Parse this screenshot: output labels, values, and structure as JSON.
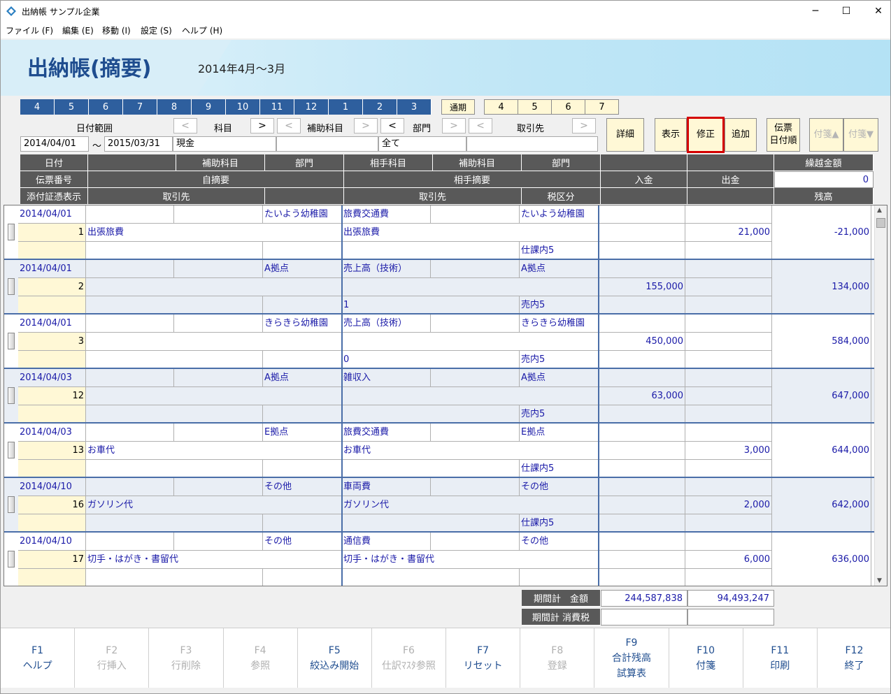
{
  "window": {
    "title": "出納帳 サンプル企業"
  },
  "menu": [
    "ファイル (F)",
    "編集 (E)",
    "移動 (I)",
    "設定 (S)",
    "ヘルプ (H)"
  ],
  "banner": {
    "title": "出納帳(摘要)",
    "period": "2014年4月～3月"
  },
  "months": [
    "4",
    "5",
    "6",
    "7",
    "8",
    "9",
    "10",
    "11",
    "12",
    "1",
    "2",
    "3"
  ],
  "months_extra": [
    "4",
    "5",
    "6",
    "7"
  ],
  "full_period": "通期",
  "filter": {
    "date_range_label": "日付範囲",
    "subject_label": "科目",
    "sub_subject_label": "補助科目",
    "dept_label": "部門",
    "partner_label": "取引先",
    "date_from": "2014/04/01",
    "tilde": "～",
    "date_to": "2015/03/31",
    "subject_value": "現金",
    "dept_value": "全て",
    "prev": "<",
    "next": ">"
  },
  "buttons": {
    "detail": "詳細",
    "show": "表示",
    "edit": "修正",
    "add": "追加",
    "slip_line1": "伝票",
    "slip_line2": "日付順",
    "fusen_up": "付箋▲",
    "fusen_down": "付箋▼"
  },
  "headers": {
    "date": "日付",
    "sub": "補助科目",
    "dept": "部門",
    "partner_subject": "相手科目",
    "partner_sub": "補助科目",
    "partner_dept": "部門",
    "carry": "繰越金額",
    "carry_value": "0",
    "slip_no": "伝票番号",
    "own_desc": "自摘要",
    "partner_desc": "相手摘要",
    "deposit": "入金",
    "withdraw": "出金",
    "attach": "添付証憑表示",
    "client": "取引先",
    "client2": "取引先",
    "tax": "税区分",
    "balance": "残高"
  },
  "entries": [
    {
      "date": "2014/04/01",
      "dept": "たいよう幼稚園",
      "psubj": "旅費交通費",
      "pdept": "たいよう幼稚園",
      "no": "1",
      "desc": "出張旅費",
      "pdesc": "出張旅費",
      "client": "",
      "tax": "仕課内5",
      "in": "",
      "out": "21,000",
      "bal": "-21,000"
    },
    {
      "date": "2014/04/01",
      "dept": "A拠点",
      "psubj": "売上高（技術）",
      "pdept": "A拠点",
      "no": "2",
      "desc": "",
      "pdesc": "",
      "client": "1",
      "tax": "売内5",
      "in": "155,000",
      "out": "",
      "bal": "134,000"
    },
    {
      "date": "2014/04/01",
      "dept": "きらきら幼稚園",
      "psubj": "売上高（技術）",
      "pdept": "きらきら幼稚園",
      "no": "3",
      "desc": "",
      "pdesc": "",
      "client": "0",
      "tax": "売内5",
      "in": "450,000",
      "out": "",
      "bal": "584,000"
    },
    {
      "date": "2014/04/03",
      "dept": "A拠点",
      "psubj": "雑収入",
      "pdept": "A拠点",
      "no": "12",
      "desc": "",
      "pdesc": "",
      "client": "",
      "tax": "売内5",
      "in": "63,000",
      "out": "",
      "bal": "647,000"
    },
    {
      "date": "2014/04/03",
      "dept": "E拠点",
      "psubj": "旅費交通費",
      "pdept": "E拠点",
      "no": "13",
      "desc": "お車代",
      "pdesc": "お車代",
      "client": "",
      "tax": "仕課内5",
      "in": "",
      "out": "3,000",
      "bal": "644,000"
    },
    {
      "date": "2014/04/10",
      "dept": "その他",
      "psubj": "車両費",
      "pdept": "その他",
      "no": "16",
      "desc": "ガソリン代",
      "pdesc": "ガソリン代",
      "client": "",
      "tax": "仕課内5",
      "in": "",
      "out": "2,000",
      "bal": "642,000"
    },
    {
      "date": "2014/04/10",
      "dept": "その他",
      "psubj": "通信費",
      "pdept": "その他",
      "no": "17",
      "desc": "切手・はがき・書留代",
      "pdesc": "切手・はがき・書留代",
      "client": "",
      "tax": "",
      "in": "",
      "out": "6,000",
      "bal": "636,000"
    }
  ],
  "totals": {
    "amount_label": "期間計　金額",
    "tax_label": "期間計 消費税",
    "in": "244,587,838",
    "out": "94,493,247"
  },
  "fkeys": [
    {
      "key": "F1",
      "l1": "ヘルプ",
      "l2": "",
      "on": true
    },
    {
      "key": "F2",
      "l1": "行挿入",
      "l2": "",
      "on": false
    },
    {
      "key": "F3",
      "l1": "行削除",
      "l2": "",
      "on": false
    },
    {
      "key": "F4",
      "l1": "参照",
      "l2": "",
      "on": false
    },
    {
      "key": "F5",
      "l1": "絞込み開始",
      "l2": "",
      "on": true
    },
    {
      "key": "F6",
      "l1": "仕訳ﾏｽﾀ参照",
      "l2": "",
      "on": false
    },
    {
      "key": "F7",
      "l1": "リセット",
      "l2": "",
      "on": true
    },
    {
      "key": "F8",
      "l1": "登録",
      "l2": "",
      "on": false
    },
    {
      "key": "F9",
      "l1": "合計残高",
      "l2": "試算表",
      "on": true
    },
    {
      "key": "F10",
      "l1": "付箋",
      "l2": "",
      "on": true
    },
    {
      "key": "F11",
      "l1": "印刷",
      "l2": "",
      "on": true
    },
    {
      "key": "F12",
      "l1": "終了",
      "l2": "",
      "on": true
    }
  ]
}
